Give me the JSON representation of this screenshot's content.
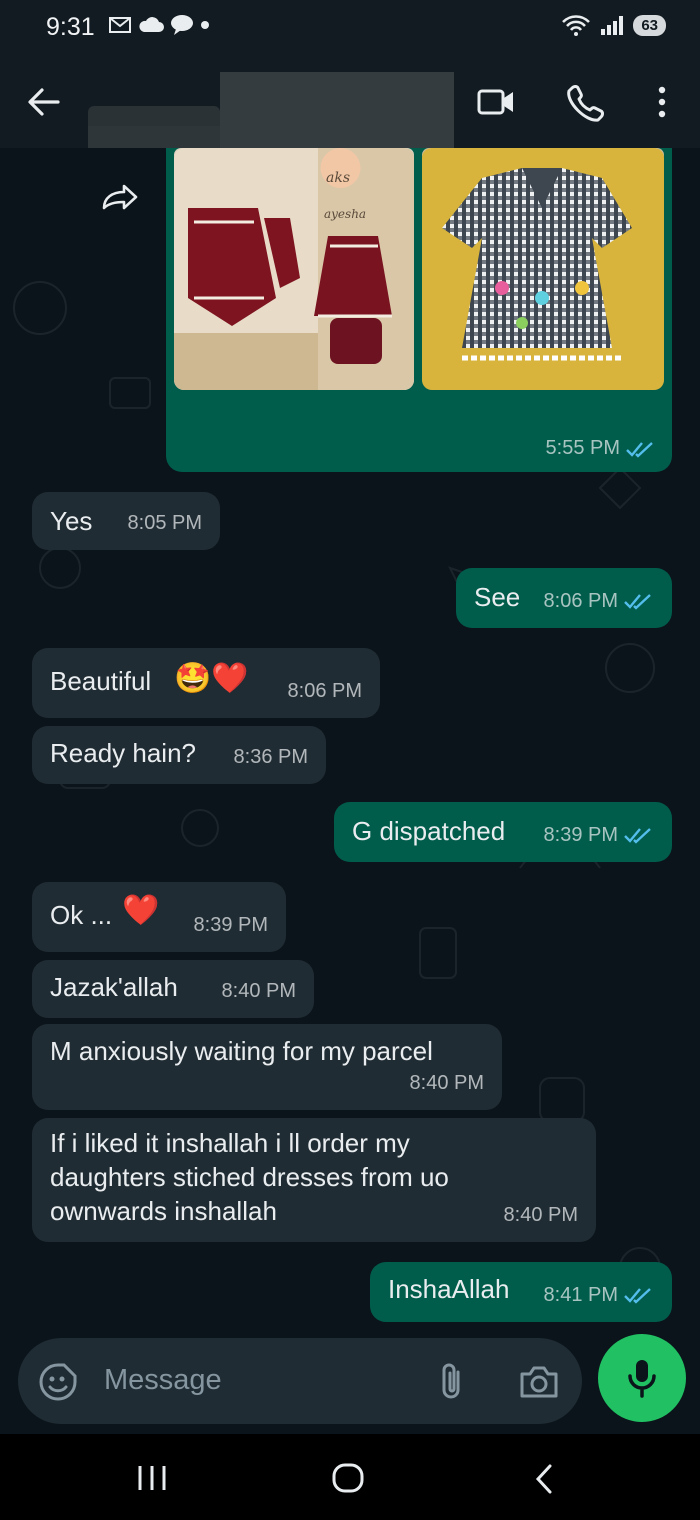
{
  "status_bar": {
    "time": "9:31",
    "battery": "63"
  },
  "header": {
    "contact_name": ""
  },
  "media_message": {
    "time": "5:55 PM",
    "photo_caption": "aks by ayesha"
  },
  "messages": [
    {
      "dir": "in",
      "text": "Yes",
      "time": "8:05 PM"
    },
    {
      "dir": "out",
      "text": "See",
      "time": "8:06 PM"
    },
    {
      "dir": "in",
      "text": "Beautiful",
      "emoji": "🤩❤️",
      "time": "8:06 PM"
    },
    {
      "dir": "in",
      "text": "Ready hain?",
      "time": "8:36 PM"
    },
    {
      "dir": "out",
      "text": "G dispatched",
      "time": "8:39 PM"
    },
    {
      "dir": "in",
      "text": "Ok ...",
      "emoji": "❤️",
      "time": "8:39 PM"
    },
    {
      "dir": "in",
      "text": "Jazak'allah",
      "time": "8:40 PM"
    },
    {
      "dir": "in",
      "text": "M anxiously waiting for my parcel",
      "time": "8:40 PM"
    },
    {
      "dir": "in",
      "text": "If i liked it inshallah i ll order my daughters stiched dresses from uo ownwards inshallah",
      "time": "8:40 PM"
    },
    {
      "dir": "out",
      "text": "InshaAllah",
      "time": "8:41 PM"
    }
  ],
  "input": {
    "placeholder": "Message"
  },
  "colors": {
    "background": "#0b141a",
    "incoming_bubble": "#202c33",
    "outgoing_bubble": "#005c4b",
    "read_ticks": "#53bdeb",
    "mic_button": "#21c063"
  },
  "icons": [
    "back-arrow-icon",
    "video-call-icon",
    "voice-call-icon",
    "more-options-icon",
    "forward-icon",
    "sticker-icon",
    "attach-icon",
    "camera-icon",
    "mic-icon",
    "recents-icon",
    "home-icon",
    "nav-back-icon"
  ]
}
